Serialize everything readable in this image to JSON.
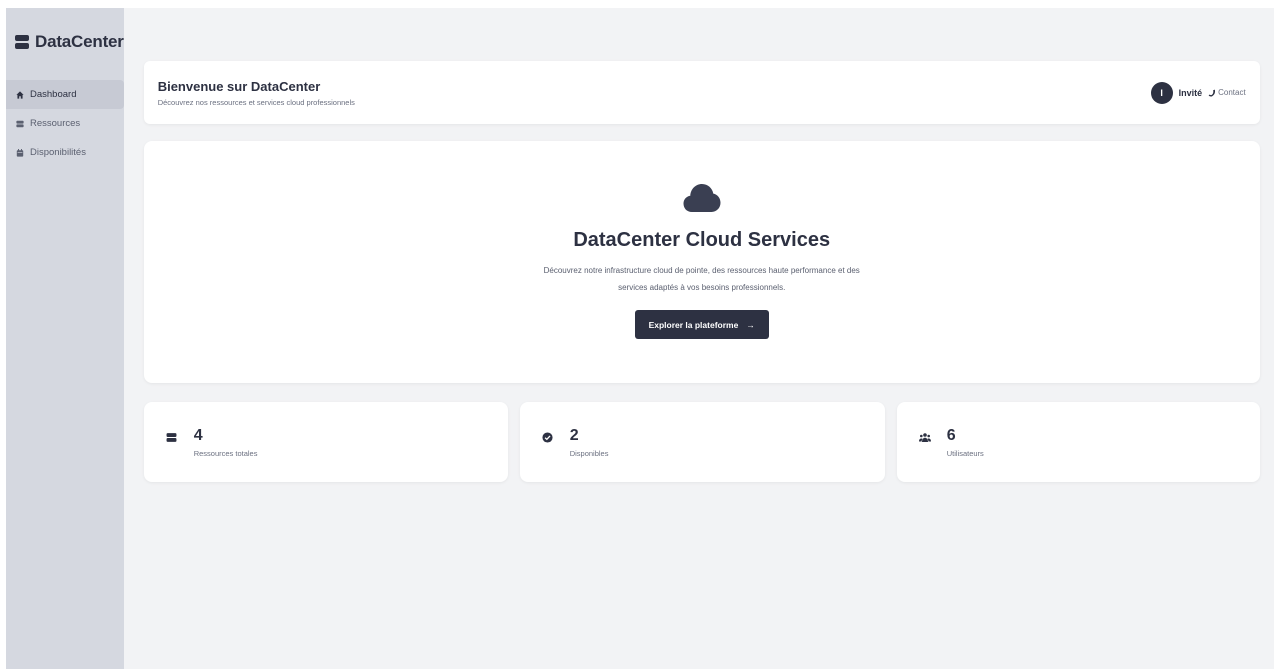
{
  "brand": {
    "name": "DataCenter",
    "icon": "server-icon"
  },
  "sidebar": {
    "items": [
      {
        "label": "Dashboard",
        "icon": "home-icon",
        "active": true
      },
      {
        "label": "Ressources",
        "icon": "server-icon",
        "active": false
      },
      {
        "label": "Disponibilités",
        "icon": "calendar-icon",
        "active": false
      }
    ]
  },
  "header": {
    "title": "Bienvenue sur DataCenter",
    "subtitle": "Découvrez nos ressources et services cloud professionnels",
    "avatar_initial": "I",
    "user_name": "Invité",
    "contact_label": "Contact"
  },
  "hero": {
    "icon": "cloud-icon",
    "title": "DataCenter Cloud Services",
    "description": "Découvrez notre infrastructure cloud de pointe, des ressources haute performance et des services adaptés à vos besoins professionnels.",
    "cta_label": "Explorer la plateforme",
    "cta_arrow": "→"
  },
  "stats": [
    {
      "value": "4",
      "label": "Ressources totales",
      "icon": "server-icon"
    },
    {
      "value": "2",
      "label": "Disponibles",
      "icon": "check-circle-icon"
    },
    {
      "value": "6",
      "label": "Utilisateurs",
      "icon": "users-icon"
    }
  ],
  "colors": {
    "primary": "#2d3142",
    "sidebar_bg": "#d5d8e0",
    "page_bg": "#f2f3f5"
  }
}
